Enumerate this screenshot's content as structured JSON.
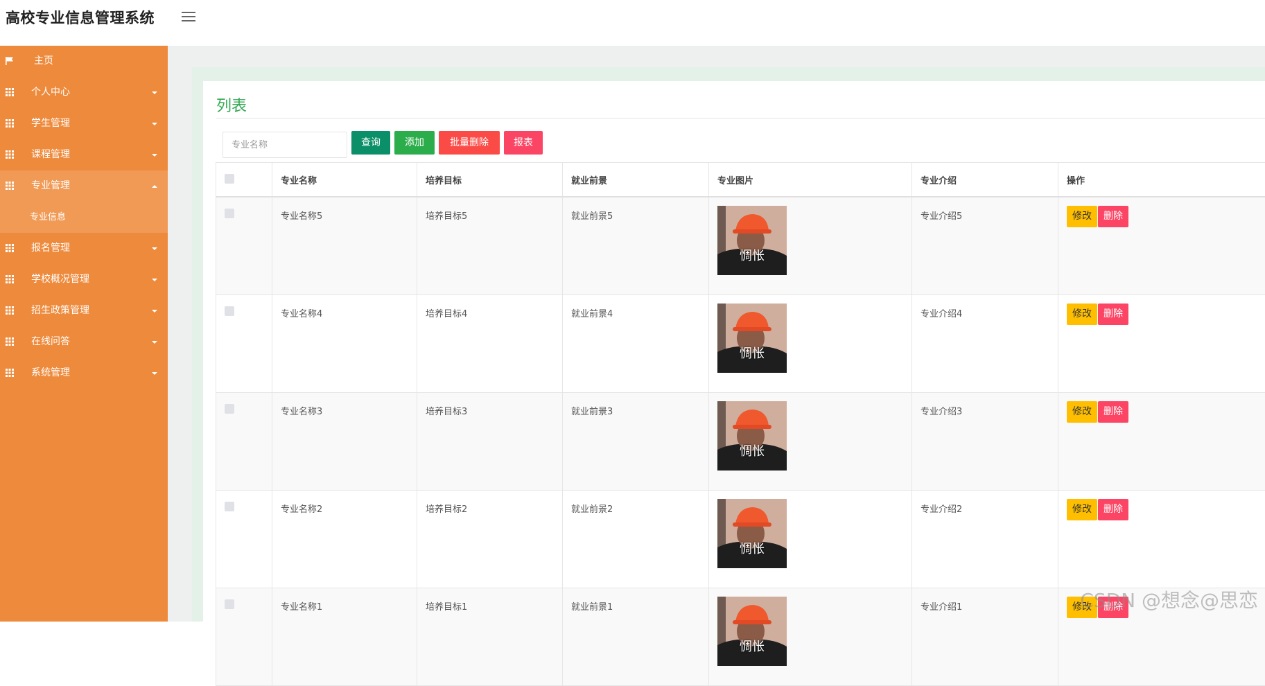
{
  "app": {
    "title": "高校专业信息管理系统"
  },
  "sidebar": {
    "home": "主页",
    "items": [
      {
        "label": "个人中心"
      },
      {
        "label": "学生管理"
      },
      {
        "label": "课程管理"
      },
      {
        "label": "专业管理",
        "expanded": true,
        "children": [
          "专业信息"
        ]
      },
      {
        "label": "报名管理"
      },
      {
        "label": "学校概况管理"
      },
      {
        "label": "招生政策管理"
      },
      {
        "label": "在线问答"
      },
      {
        "label": "系统管理"
      }
    ]
  },
  "main": {
    "title": "列表",
    "search": {
      "placeholder": "专业名称",
      "value": ""
    },
    "buttons": {
      "query": "查询",
      "add": "添加",
      "batch_delete": "批量删除",
      "report": "报表"
    },
    "table": {
      "columns": [
        "专业名称",
        "培养目标",
        "就业前景",
        "专业图片",
        "专业介绍",
        "操作"
      ],
      "rows": [
        {
          "name": "专业名称5",
          "goal": "培养目标5",
          "prospect": "就业前景5",
          "image_caption": "惆怅",
          "intro": "专业介绍5"
        },
        {
          "name": "专业名称4",
          "goal": "培养目标4",
          "prospect": "就业前景4",
          "image_caption": "惆怅",
          "intro": "专业介绍4"
        },
        {
          "name": "专业名称3",
          "goal": "培养目标3",
          "prospect": "就业前景3",
          "image_caption": "惆怅",
          "intro": "专业介绍3"
        },
        {
          "name": "专业名称2",
          "goal": "培养目标2",
          "prospect": "就业前景2",
          "image_caption": "惆怅",
          "intro": "专业介绍2"
        },
        {
          "name": "专业名称1",
          "goal": "培养目标1",
          "prospect": "就业前景1",
          "image_caption": "惆怅",
          "intro": "专业介绍1"
        }
      ],
      "row_actions": {
        "edit": "修改",
        "delete": "删除"
      }
    }
  },
  "watermark": "CSDN @想念@思恋",
  "colors": {
    "sidebar": "#ee8a3b",
    "sidebar_active": "#f09a55",
    "title_green": "#33a852"
  },
  "icons": {
    "home": "flag-icon",
    "menu": "grid-icon",
    "toggle": "hamburger-icon"
  }
}
